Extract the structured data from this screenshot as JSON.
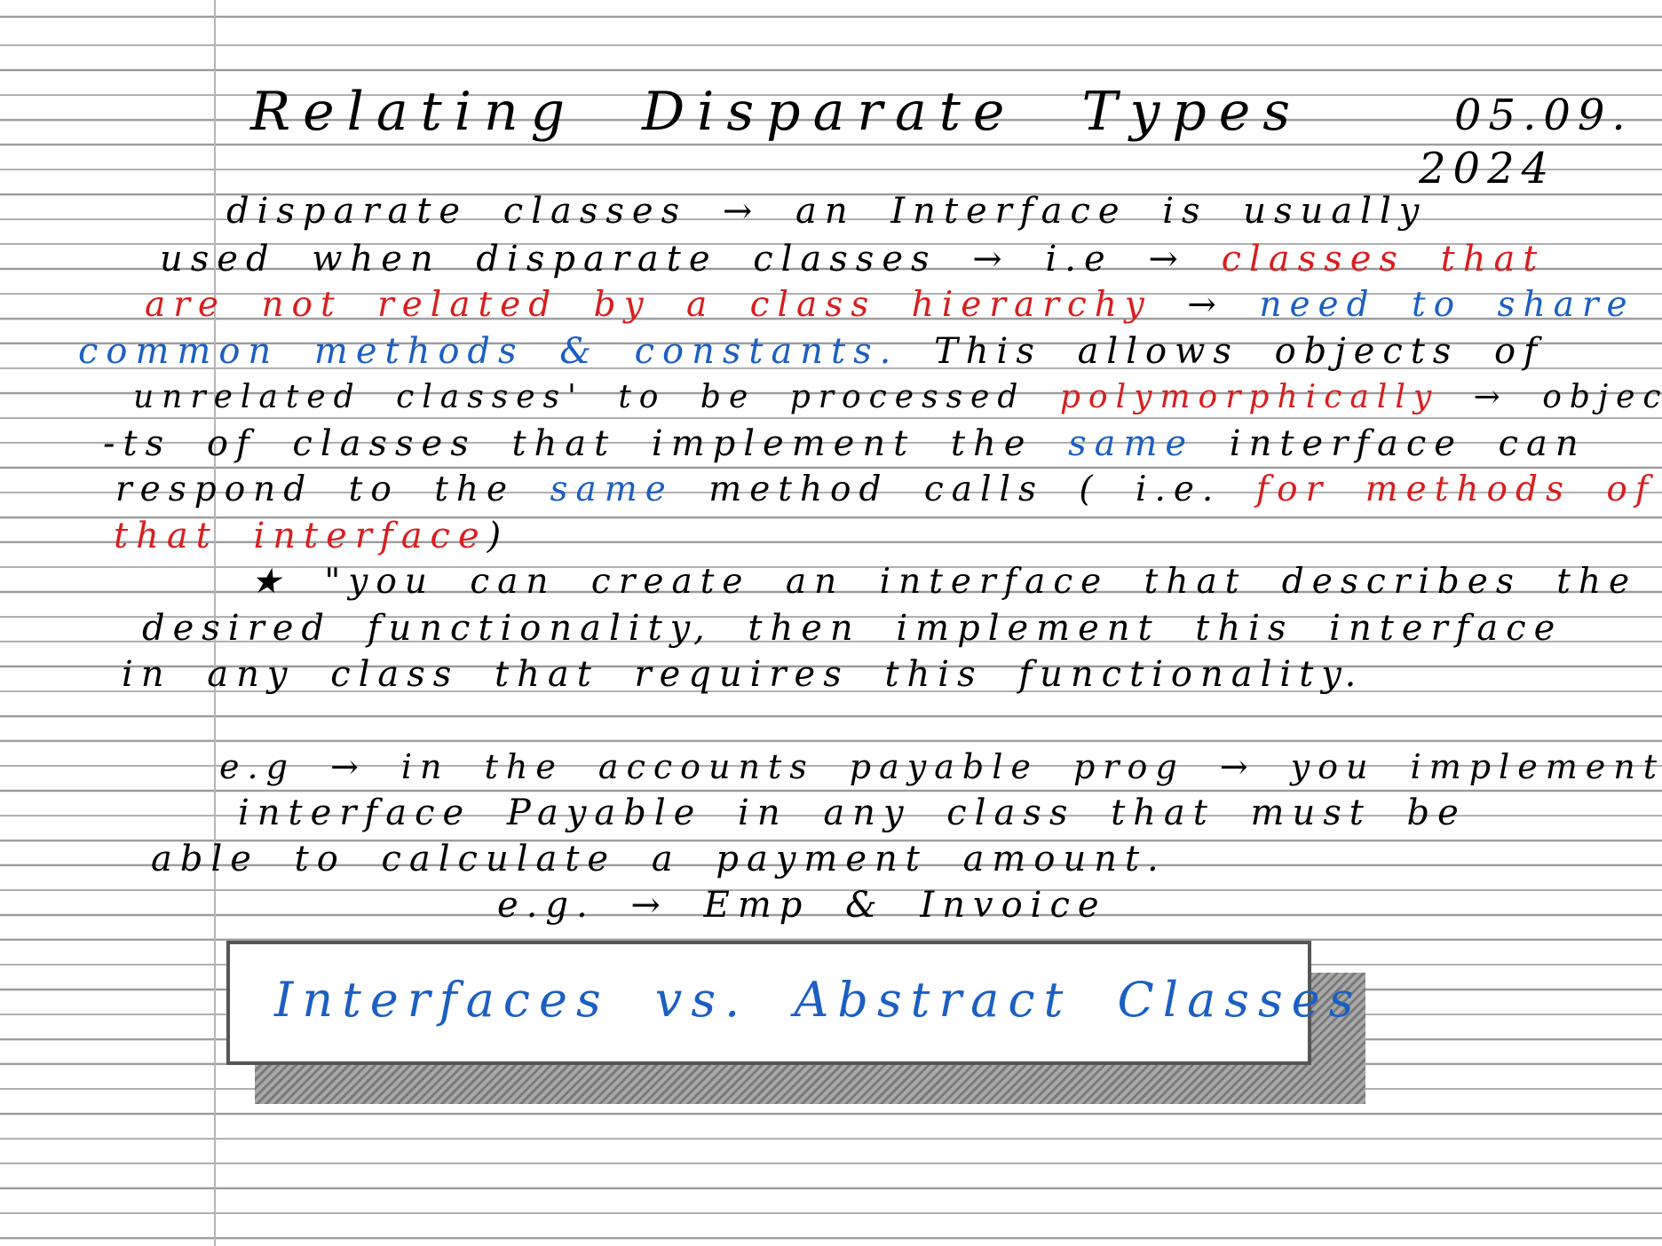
{
  "note": {
    "title": "Relating Disparate Types",
    "date_line1": "05.09.",
    "date_line2": "2024",
    "lines": [
      [
        {
          "t": "disparate classes → an Interface is usually",
          "c": "black"
        }
      ],
      [
        {
          "t": "used when disparate classes → i.e → ",
          "c": "black"
        },
        {
          "t": "classes that",
          "c": "red"
        }
      ],
      [
        {
          "t": "are not related by a class hierarchy",
          "c": "red"
        },
        {
          "t": " → ",
          "c": "black"
        },
        {
          "t": "need to share",
          "c": "blue"
        }
      ],
      [
        {
          "t": "common methods & constants.",
          "c": "blue"
        },
        {
          "t": " This allows objects of",
          "c": "black"
        }
      ],
      [
        {
          "t": "unrelated classes' to be processed ",
          "c": "black"
        },
        {
          "t": "polymorphically",
          "c": "red"
        },
        {
          "t": " → objec",
          "c": "black"
        }
      ],
      [
        {
          "t": "-ts of classes that implement the ",
          "c": "black"
        },
        {
          "t": "same",
          "c": "blue"
        },
        {
          "t": " interface can",
          "c": "black"
        }
      ],
      [
        {
          "t": "respond to the ",
          "c": "black"
        },
        {
          "t": "same",
          "c": "blue"
        },
        {
          "t": " method calls ( i.e. ",
          "c": "black"
        },
        {
          "t": "for methods of",
          "c": "red"
        }
      ],
      [
        {
          "t": "that interface",
          "c": "red"
        },
        {
          "t": ")",
          "c": "black"
        }
      ],
      [
        {
          "t": "★ \"you can create an interface that describes the",
          "c": "black"
        }
      ],
      [
        {
          "t": "desired functionality, then implement this interface",
          "c": "black"
        }
      ],
      [
        {
          "t": "in any class that requires this functionality.",
          "c": "black"
        }
      ],
      [
        {
          "t": "e.g → in the accounts payable prog → you implement",
          "c": "black"
        }
      ],
      [
        {
          "t": "interface Payable in any class that must be",
          "c": "black"
        }
      ],
      [
        {
          "t": "able to calculate a payment amount.",
          "c": "black"
        }
      ],
      [
        {
          "t": "e.g. → Emp & Invoice",
          "c": "black"
        }
      ]
    ],
    "box_heading": "Interfaces vs. Abstract Classes"
  },
  "colors": {
    "ink": "#000000",
    "red": "#d81e1e",
    "blue": "#1c5fc2",
    "rule_line": "#9a9a9a",
    "margin_line": "#b5b5b5",
    "box_border": "#555555",
    "shadow": "#8e8e8e"
  }
}
